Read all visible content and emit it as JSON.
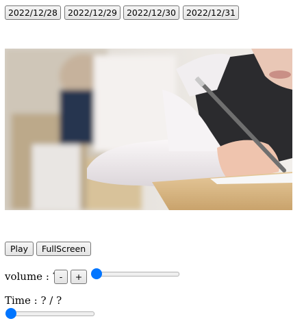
{
  "date_buttons": [
    "2022/12/28",
    "2022/12/29",
    "2022/12/30",
    "2022/12/31"
  ],
  "controls": {
    "play_label": "Play",
    "fullscreen_label": "FullScreen",
    "volume_label": "volume : ?",
    "volume_minus": "-",
    "volume_plus": "+",
    "time_label": "Time : ? / ?"
  },
  "volume_level": 0,
  "seek_position": 0,
  "accent_color": "#0075ff"
}
